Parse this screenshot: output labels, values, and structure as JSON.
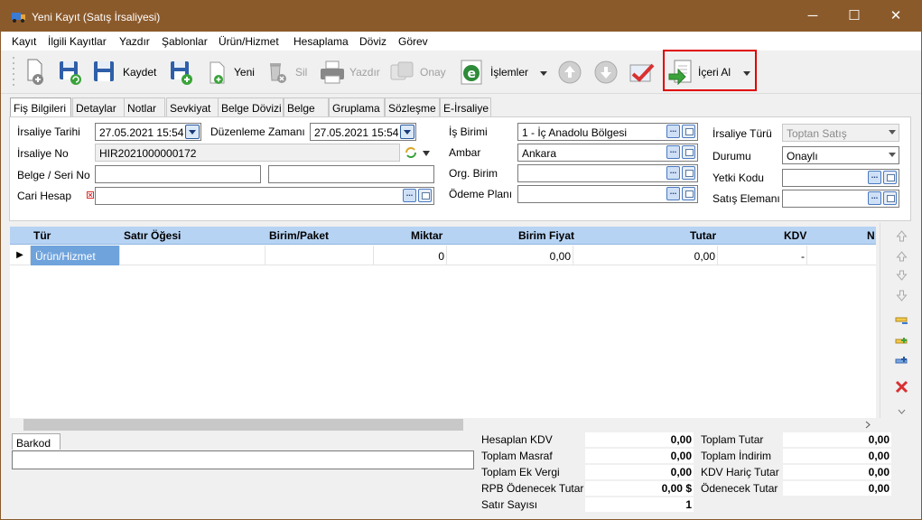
{
  "window": {
    "title": "Yeni Kayıt (Satış İrsaliyesi)",
    "min": "─",
    "max": "☐",
    "close": "✕"
  },
  "menu": [
    "Kayıt",
    "İlgili Kayıtlar",
    "Yazdır",
    "Şablonlar",
    "Ürün/Hizmet",
    "Hesaplama",
    "Döviz",
    "Görev"
  ],
  "toolbar": {
    "kaydet": "Kaydet",
    "yeni": "Yeni",
    "sil": "Sil",
    "yazdir": "Yazdır",
    "onay": "Onay",
    "islemler": "İşlemler",
    "iceri_al": "İçeri Al"
  },
  "tabs": [
    "Fiş Bilgileri",
    "Detaylar",
    "Notlar",
    "Sevkiyat",
    "Belge Dövizi",
    "Belge",
    "Gruplama",
    "Sözleşme",
    "E-İrsaliye"
  ],
  "form": {
    "irsaliye_tarihi_label": "İrsaliye Tarihi",
    "irsaliye_tarihi": "27.05.2021 15:54",
    "duzenleme_zamani_label": "Düzenleme Zamanı",
    "duzenleme_zamani": "27.05.2021 15:54",
    "irsaliye_no_label": "İrsaliye No",
    "irsaliye_no": "HIR2021000000172",
    "belge_seri_no_label": "Belge / Seri No",
    "belge_no": "",
    "seri_no": "",
    "cari_hesap_label": "Cari Hesap",
    "cari_hesap": "",
    "is_birimi_label": "İş Birimi",
    "is_birimi": "1 - İç Anadolu Bölgesi",
    "ambar_label": "Ambar",
    "ambar": "Ankara",
    "org_birim_label": "Org. Birim",
    "org_birim": "",
    "odeme_plani_label": "Ödeme Planı",
    "odeme_plani": "",
    "irsaliye_turu_label": "İrsaliye Türü",
    "irsaliye_turu": "Toptan Satış",
    "durumu_label": "Durumu",
    "durumu": "Onaylı",
    "yetki_kodu_label": "Yetki Kodu",
    "yetki_kodu": "",
    "satis_elemani_label": "Satış Elemanı",
    "satis_elemani": "",
    "ellipsis": "..."
  },
  "grid": {
    "headers": [
      "Tür",
      "Satır Öğesi",
      "Birim/Paket",
      "Miktar",
      "Birim Fiyat",
      "Tutar",
      "KDV",
      "N"
    ],
    "row": {
      "tur": "Ürün/Hizmet",
      "satir_ogesi": "",
      "birim_paket": "",
      "miktar": "0",
      "birim_fiyat": "0,00",
      "tutar": "0,00",
      "kdv": "-"
    },
    "row_indicator": "▶"
  },
  "barkod": {
    "tab": "Barkod",
    "value": ""
  },
  "totals_left": [
    {
      "label": "Hesaplan KDV",
      "value": "0,00"
    },
    {
      "label": "Toplam Masraf",
      "value": "0,00"
    },
    {
      "label": "Toplam Ek Vergi",
      "value": "0,00"
    },
    {
      "label": "RPB Ödenecek Tutar",
      "value": "0,00 $"
    },
    {
      "label": "Satır Sayısı",
      "value": "1"
    }
  ],
  "totals_right": [
    {
      "label": "Toplam Tutar",
      "value": "0,00"
    },
    {
      "label": "Toplam İndirim",
      "value": "0,00"
    },
    {
      "label": "KDV Hariç Tutar",
      "value": "0,00"
    },
    {
      "label": "Ödenecek Tutar",
      "value": "0,00"
    }
  ],
  "colors": {
    "titlebar": "#8b5a2b",
    "grid_header": "#b7d3f3",
    "selected_cell": "#6fa3dc",
    "highlight_box": "#e00000"
  }
}
